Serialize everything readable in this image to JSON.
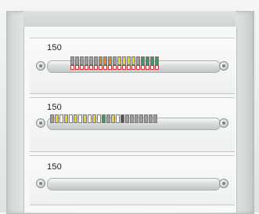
{
  "panels": [
    {
      "label": "150"
    },
    {
      "label": "150"
    },
    {
      "label": "150"
    }
  ],
  "colors": {
    "yellow": "#e8d21a",
    "green": "#2aa84a",
    "orange": "#e08a1d",
    "gray": "#9a9e9e",
    "red_mark": "#d22222"
  },
  "icons": [
    "screw-icon",
    "terminal-block-icon",
    "din-rail-icon"
  ]
}
